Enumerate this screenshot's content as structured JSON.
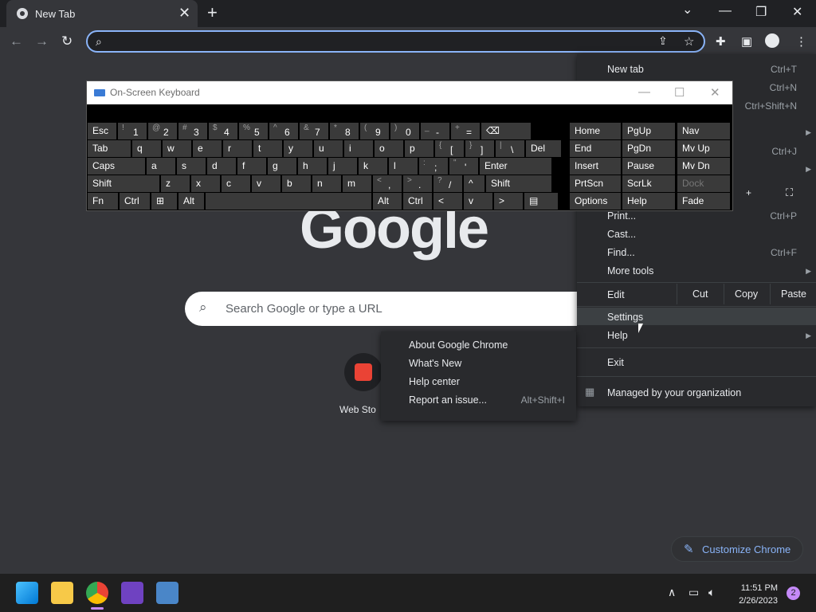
{
  "tab": {
    "title": "New Tab",
    "close": "✕"
  },
  "newtab": "+",
  "window_controls": {
    "dropdown": "⌄",
    "minimize": "—",
    "restore": "❐",
    "close": "✕"
  },
  "nav": {
    "back": "←",
    "forward": "→",
    "reload": "↻"
  },
  "omnibox": {
    "value": ""
  },
  "page": {
    "logo": "Google",
    "search_placeholder": "Search Google or type a URL",
    "shortcut_label": "Web Sto",
    "customize_label": "Customize Chrome"
  },
  "menu": {
    "items": [
      {
        "label": "New tab",
        "shortcut": "Ctrl+T"
      },
      {
        "label": "",
        "shortcut": "Ctrl+N"
      },
      {
        "label": "",
        "shortcut": "Ctrl+Shift+N"
      },
      {
        "label": "",
        "shortcut": "Ctrl+J"
      },
      {
        "label": "Print...",
        "shortcut": "Ctrl+P"
      },
      {
        "label": "Cast...",
        "shortcut": ""
      },
      {
        "label": "Find...",
        "shortcut": "Ctrl+F"
      },
      {
        "label": "More tools",
        "shortcut": ""
      },
      {
        "label": "Edit",
        "shortcut": ""
      },
      {
        "label": "Settings",
        "shortcut": ""
      },
      {
        "label": "Help",
        "shortcut": ""
      },
      {
        "label": "Exit",
        "shortcut": ""
      },
      {
        "label": "Managed by your organization",
        "shortcut": ""
      }
    ],
    "zoom_plus": "+",
    "edit": {
      "cut": "Cut",
      "copy": "Copy",
      "paste": "Paste"
    }
  },
  "help_submenu": [
    {
      "label": "About Google Chrome",
      "shortcut": ""
    },
    {
      "label": "What's New",
      "shortcut": ""
    },
    {
      "label": "Help center",
      "shortcut": ""
    },
    {
      "label": "Report an issue...",
      "shortcut": "Alt+Shift+I"
    }
  ],
  "osk": {
    "title": "On-Screen Keyboard",
    "row1": [
      "Esc",
      "1",
      "2",
      "3",
      "4",
      "5",
      "6",
      "7",
      "8",
      "9",
      "0",
      "-",
      "=",
      "⌫"
    ],
    "row1_sub": [
      "",
      "!",
      "@",
      "#",
      "$",
      "%",
      "^",
      "&",
      "*",
      "(",
      ")",
      "_",
      "+",
      ""
    ],
    "row2": [
      "Tab",
      "q",
      "w",
      "e",
      "r",
      "t",
      "y",
      "u",
      "i",
      "o",
      "p",
      "[",
      "]",
      "\\",
      "Del"
    ],
    "row2_sub": [
      "",
      "",
      "",
      "",
      "",
      "",
      "",
      "",
      "",
      "",
      "",
      "{",
      "}",
      "|",
      ""
    ],
    "row3": [
      "Caps",
      "a",
      "s",
      "d",
      "f",
      "g",
      "h",
      "j",
      "k",
      "l",
      ";",
      "'",
      "Enter"
    ],
    "row3_sub": [
      "",
      "",
      "",
      "",
      "",
      "",
      "",
      "",
      "",
      "",
      ":",
      "\"",
      ""
    ],
    "row4": [
      "Shift",
      "z",
      "x",
      "c",
      "v",
      "b",
      "n",
      "m",
      ",",
      ".",
      "/",
      "^",
      "Shift"
    ],
    "row4_sub": [
      "",
      "",
      "",
      "",
      "",
      "",
      "",
      "",
      "<",
      ">",
      "?",
      "",
      ""
    ],
    "row5": [
      "Fn",
      "Ctrl",
      "⊞",
      "Alt",
      "",
      "Alt",
      "Ctrl",
      "<",
      "v",
      ">",
      "▤"
    ],
    "nav": [
      [
        "Home",
        "PgUp",
        "Nav"
      ],
      [
        "End",
        "PgDn",
        "Mv Up"
      ],
      [
        "Insert",
        "Pause",
        "Mv Dn"
      ],
      [
        "PrtScn",
        "ScrLk",
        "Dock"
      ],
      [
        "Options",
        "Help",
        "Fade"
      ]
    ]
  },
  "taskbar": {
    "time": "11:51 PM",
    "date": "2/26/2023",
    "notifications": "2"
  },
  "colors": {
    "accent": "#8ab4f8",
    "bg": "#35363a",
    "menu": "#292a2d"
  }
}
